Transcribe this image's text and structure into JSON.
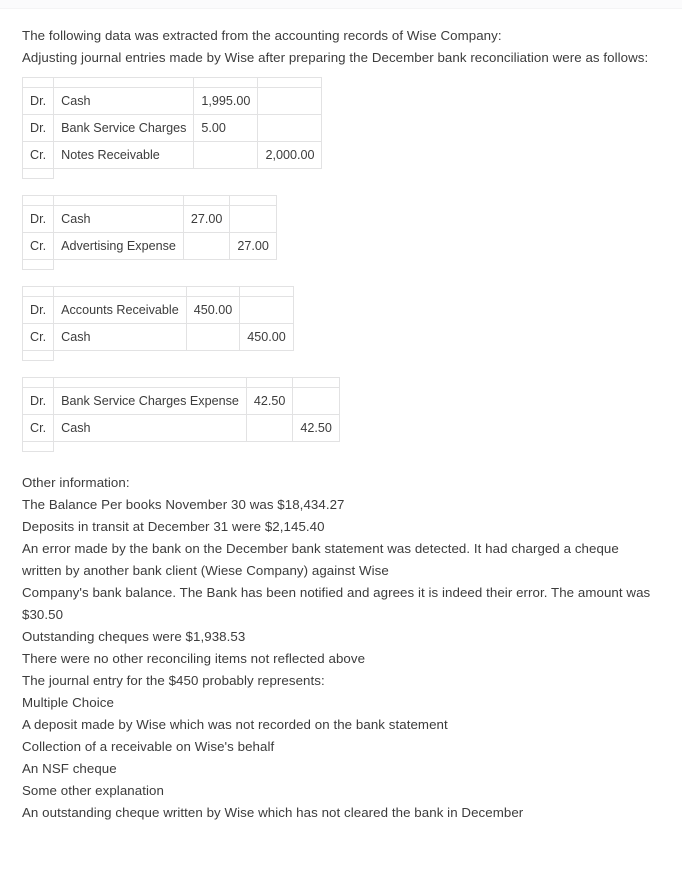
{
  "document": {
    "intro": [
      "The following data was extracted from the accounting records of Wise Company:",
      "Adjusting journal entries made by Wise after preparing the December bank reconciliation were as follows:"
    ],
    "journal_entries": [
      {
        "id": "entry-1",
        "rows": [
          {
            "type": "Dr.",
            "account": "Cash",
            "debit": "1,995.00",
            "credit": ""
          },
          {
            "type": "Dr.",
            "account": "Bank Service Charges",
            "debit": "5.00",
            "credit": ""
          },
          {
            "type": "Cr.",
            "account": "Notes Receivable",
            "debit": "",
            "credit": "2,000.00"
          }
        ]
      },
      {
        "id": "entry-2",
        "rows": [
          {
            "type": "Dr.",
            "account": "Cash",
            "debit": "27.00",
            "credit": ""
          },
          {
            "type": "Cr.",
            "account": "Advertising Expense",
            "debit": "",
            "credit": "27.00"
          }
        ]
      },
      {
        "id": "entry-3",
        "rows": [
          {
            "type": "Dr.",
            "account": "Accounts Receivable",
            "debit": "450.00",
            "credit": ""
          },
          {
            "type": "Cr.",
            "account": "Cash",
            "debit": "",
            "credit": "450.00"
          }
        ]
      },
      {
        "id": "entry-4",
        "rows": [
          {
            "type": "Dr.",
            "account": "Bank Service Charges Expense",
            "debit": "42.50",
            "credit": ""
          },
          {
            "type": "Cr.",
            "account": "Cash",
            "debit": "",
            "credit": "42.50"
          }
        ]
      }
    ],
    "other_information": {
      "heading": "Other information:",
      "lines": [
        "The Balance Per books November 30 was $18,434.27",
        "Deposits in transit at December 31 were $2,145.40",
        "An error made by the bank on the December bank statement was detected. It had charged a cheque written by another bank client (Wiese Company) against Wise",
        "Company's bank balance. The Bank has been notified and agrees it is indeed their error. The amount was $30.50",
        "Outstanding cheques were $1,938.53",
        "There were no other reconciling items not reflected above"
      ]
    },
    "question": {
      "prompt": "The journal entry for the $450 probably represents:",
      "type_label": "Multiple Choice",
      "options": [
        "A deposit made by Wise which was not recorded on the bank statement",
        "Collection of a receivable on Wise's behalf",
        "An NSF cheque",
        "Some other explanation",
        "An outstanding cheque written by Wise which has not cleared the bank in December"
      ]
    }
  }
}
